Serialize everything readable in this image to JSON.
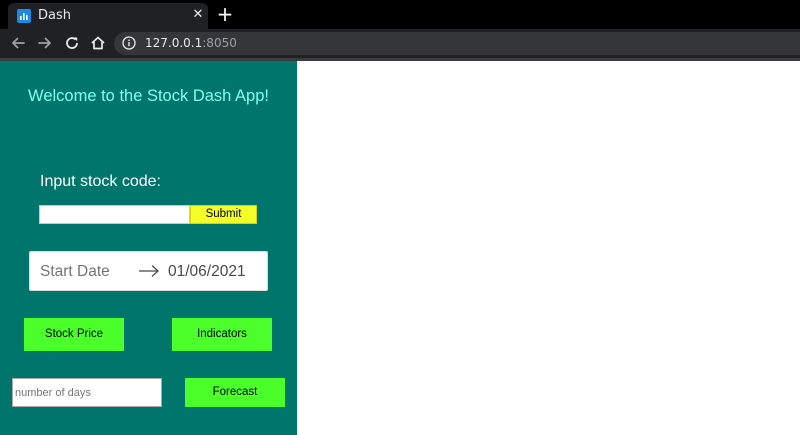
{
  "browser": {
    "tab_title": "Dash",
    "close_glyph": "✕",
    "newtab_glyph": "+",
    "url_host": "127.0.0.1",
    "url_port": ":8050",
    "icons": [
      "back-icon",
      "forward-icon",
      "reload-icon",
      "home-icon",
      "info-icon",
      "dash-favicon"
    ]
  },
  "sidebar": {
    "welcome": "Welcome to the Stock Dash App!",
    "code_label": "Input stock code:",
    "stock_input_value": "",
    "submit_label": "Submit",
    "date_start_placeholder": "Start Date",
    "date_end_value": "01/06/2021",
    "stock_price_label": "Stock Price",
    "indicators_label": "Indicators",
    "days_placeholder": "number of days",
    "forecast_label": "Forecast"
  },
  "colors": {
    "sidebar_bg": "#00756b",
    "welcome_text": "#7fffef",
    "submit_bg": "#f4ff2a",
    "action_button_bg": "#4bff2a"
  }
}
